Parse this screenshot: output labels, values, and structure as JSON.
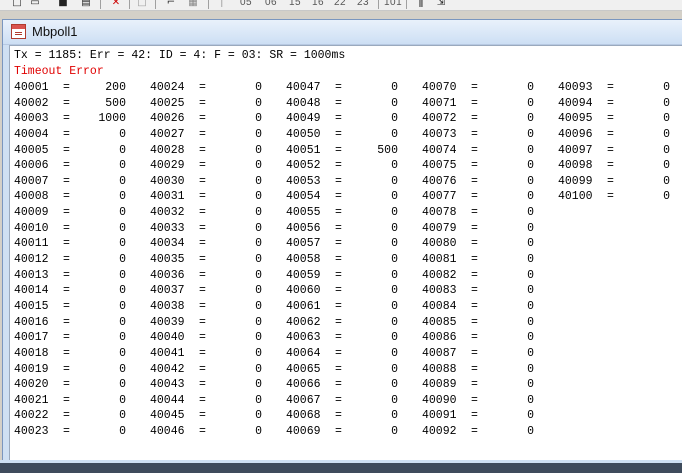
{
  "toolbar": {
    "icons": [
      "new-file-icon",
      "open-folder-icon",
      "save-icon",
      "print-icon",
      "disconnect-icon",
      "blank-document-icon",
      "connect-icon",
      "read-write-icon",
      "rtu-icon",
      "tcp-icon"
    ],
    "function_codes": [
      "05",
      "06",
      "15",
      "16",
      "22",
      "23",
      "101"
    ]
  },
  "window": {
    "title": "Mbpoll1",
    "status_line": "Tx = 1185: Err = 42: ID = 4: F = 03: SR = 1000ms",
    "error_line": "Timeout Error",
    "error_color": "#e00000"
  },
  "registers": [
    {
      "addr": "40001",
      "val": "200"
    },
    {
      "addr": "40002",
      "val": "500"
    },
    {
      "addr": "40003",
      "val": "1000"
    },
    {
      "addr": "40004",
      "val": "0"
    },
    {
      "addr": "40005",
      "val": "0"
    },
    {
      "addr": "40006",
      "val": "0"
    },
    {
      "addr": "40007",
      "val": "0"
    },
    {
      "addr": "40008",
      "val": "0"
    },
    {
      "addr": "40009",
      "val": "0"
    },
    {
      "addr": "40010",
      "val": "0"
    },
    {
      "addr": "40011",
      "val": "0"
    },
    {
      "addr": "40012",
      "val": "0"
    },
    {
      "addr": "40013",
      "val": "0"
    },
    {
      "addr": "40014",
      "val": "0"
    },
    {
      "addr": "40015",
      "val": "0"
    },
    {
      "addr": "40016",
      "val": "0"
    },
    {
      "addr": "40017",
      "val": "0"
    },
    {
      "addr": "40018",
      "val": "0"
    },
    {
      "addr": "40019",
      "val": "0"
    },
    {
      "addr": "40020",
      "val": "0"
    },
    {
      "addr": "40021",
      "val": "0"
    },
    {
      "addr": "40022",
      "val": "0"
    },
    {
      "addr": "40023",
      "val": "0"
    },
    {
      "addr": "40024",
      "val": "0"
    },
    {
      "addr": "40025",
      "val": "0"
    },
    {
      "addr": "40026",
      "val": "0"
    },
    {
      "addr": "40027",
      "val": "0"
    },
    {
      "addr": "40028",
      "val": "0"
    },
    {
      "addr": "40029",
      "val": "0"
    },
    {
      "addr": "40030",
      "val": "0"
    },
    {
      "addr": "40031",
      "val": "0"
    },
    {
      "addr": "40032",
      "val": "0"
    },
    {
      "addr": "40033",
      "val": "0"
    },
    {
      "addr": "40034",
      "val": "0"
    },
    {
      "addr": "40035",
      "val": "0"
    },
    {
      "addr": "40036",
      "val": "0"
    },
    {
      "addr": "40037",
      "val": "0"
    },
    {
      "addr": "40038",
      "val": "0"
    },
    {
      "addr": "40039",
      "val": "0"
    },
    {
      "addr": "40040",
      "val": "0"
    },
    {
      "addr": "40041",
      "val": "0"
    },
    {
      "addr": "40042",
      "val": "0"
    },
    {
      "addr": "40043",
      "val": "0"
    },
    {
      "addr": "40044",
      "val": "0"
    },
    {
      "addr": "40045",
      "val": "0"
    },
    {
      "addr": "40046",
      "val": "0"
    },
    {
      "addr": "40047",
      "val": "0"
    },
    {
      "addr": "40048",
      "val": "0"
    },
    {
      "addr": "40049",
      "val": "0"
    },
    {
      "addr": "40050",
      "val": "0"
    },
    {
      "addr": "40051",
      "val": "500"
    },
    {
      "addr": "40052",
      "val": "0"
    },
    {
      "addr": "40053",
      "val": "0"
    },
    {
      "addr": "40054",
      "val": "0"
    },
    {
      "addr": "40055",
      "val": "0"
    },
    {
      "addr": "40056",
      "val": "0"
    },
    {
      "addr": "40057",
      "val": "0"
    },
    {
      "addr": "40058",
      "val": "0"
    },
    {
      "addr": "40059",
      "val": "0"
    },
    {
      "addr": "40060",
      "val": "0"
    },
    {
      "addr": "40061",
      "val": "0"
    },
    {
      "addr": "40062",
      "val": "0"
    },
    {
      "addr": "40063",
      "val": "0"
    },
    {
      "addr": "40064",
      "val": "0"
    },
    {
      "addr": "40065",
      "val": "0"
    },
    {
      "addr": "40066",
      "val": "0"
    },
    {
      "addr": "40067",
      "val": "0"
    },
    {
      "addr": "40068",
      "val": "0"
    },
    {
      "addr": "40069",
      "val": "0"
    },
    {
      "addr": "40070",
      "val": "0"
    },
    {
      "addr": "40071",
      "val": "0"
    },
    {
      "addr": "40072",
      "val": "0"
    },
    {
      "addr": "40073",
      "val": "0"
    },
    {
      "addr": "40074",
      "val": "0"
    },
    {
      "addr": "40075",
      "val": "0"
    },
    {
      "addr": "40076",
      "val": "0"
    },
    {
      "addr": "40077",
      "val": "0"
    },
    {
      "addr": "40078",
      "val": "0"
    },
    {
      "addr": "40079",
      "val": "0"
    },
    {
      "addr": "40080",
      "val": "0"
    },
    {
      "addr": "40081",
      "val": "0"
    },
    {
      "addr": "40082",
      "val": "0"
    },
    {
      "addr": "40083",
      "val": "0"
    },
    {
      "addr": "40084",
      "val": "0"
    },
    {
      "addr": "40085",
      "val": "0"
    },
    {
      "addr": "40086",
      "val": "0"
    },
    {
      "addr": "40087",
      "val": "0"
    },
    {
      "addr": "40088",
      "val": "0"
    },
    {
      "addr": "40089",
      "val": "0"
    },
    {
      "addr": "40090",
      "val": "0"
    },
    {
      "addr": "40091",
      "val": "0"
    },
    {
      "addr": "40092",
      "val": "0"
    },
    {
      "addr": "40093",
      "val": "0"
    },
    {
      "addr": "40094",
      "val": "0"
    },
    {
      "addr": "40095",
      "val": "0"
    },
    {
      "addr": "40096",
      "val": "0"
    },
    {
      "addr": "40097",
      "val": "0"
    },
    {
      "addr": "40098",
      "val": "0"
    },
    {
      "addr": "40099",
      "val": "0"
    },
    {
      "addr": "40100",
      "val": "0"
    }
  ],
  "rows_per_column": 23
}
